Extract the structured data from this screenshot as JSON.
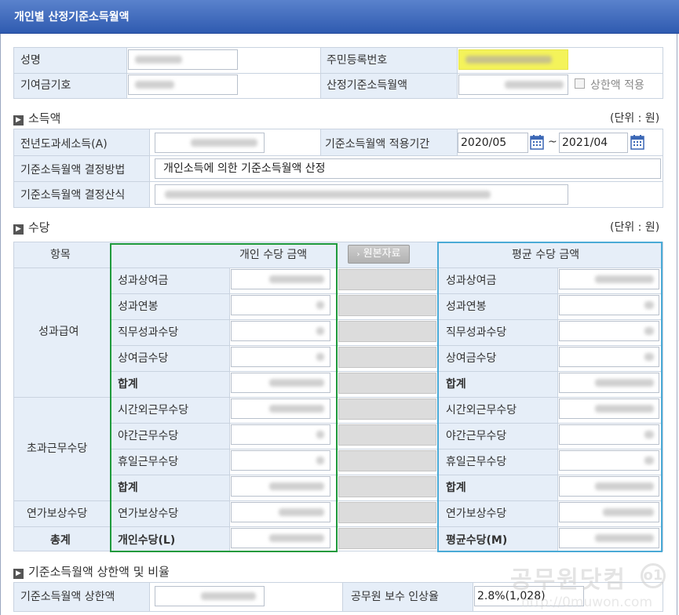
{
  "window_title": "개인별 산정기준소득월액",
  "top": {
    "name_label": "성명",
    "ssn_label": "주민등록번호",
    "pension_no_label": "기여금기호",
    "monthly_label": "산정기준소득월액",
    "limit_checkbox_label": "상한액 적용"
  },
  "income": {
    "section_title": "소득액",
    "unit": "(단위 : 원)",
    "prev_year_label": "전년도과세소득(A)",
    "period_label": "기준소득월액 적용기간",
    "period_from": "2020/05",
    "period_sep": "~",
    "period_to": "2021/04",
    "method_label": "기준소득월액 결정방법",
    "method_value": "개인소득에 의한 기준소득월액 산정",
    "formula_label": "기준소득월액 결정산식"
  },
  "allowance": {
    "section_title": "수당",
    "unit": "(단위 : 원)",
    "col_item": "항목",
    "col_personal": "개인 수당 금액",
    "source_button": "원본자료",
    "col_average": "평균 수당 금액",
    "groups": [
      {
        "name": "성과급여",
        "items": [
          "성과상여금",
          "성과연봉",
          "직무성과수당",
          "상여금수당",
          "합계"
        ]
      },
      {
        "name": "초과근무수당",
        "items": [
          "시간외근무수당",
          "야간근무수당",
          "휴일근무수당",
          "합계"
        ]
      },
      {
        "name": "연가보상수당",
        "items": [
          "연가보상수당"
        ]
      }
    ],
    "total_label": "총계",
    "personal_total_label": "개인수당(L)",
    "average_total_label": "평균수당(M)"
  },
  "limit": {
    "section_title": "기준소득월액 상한액 및 비율",
    "limit_label": "기준소득월액 상한액",
    "raise_label": "공무원 보수 인상율",
    "raise_value": "2.8%(1,028)"
  },
  "watermark": {
    "text": "공무원닷컴",
    "url": "http://0muwon.com"
  },
  "colors": {
    "title_bar": "#3a64b8",
    "label_bg": "#e6eef8",
    "personal_border": "#1f9a3c",
    "average_border": "#4aaad6",
    "ssn_highlight": "#f4f35a"
  }
}
